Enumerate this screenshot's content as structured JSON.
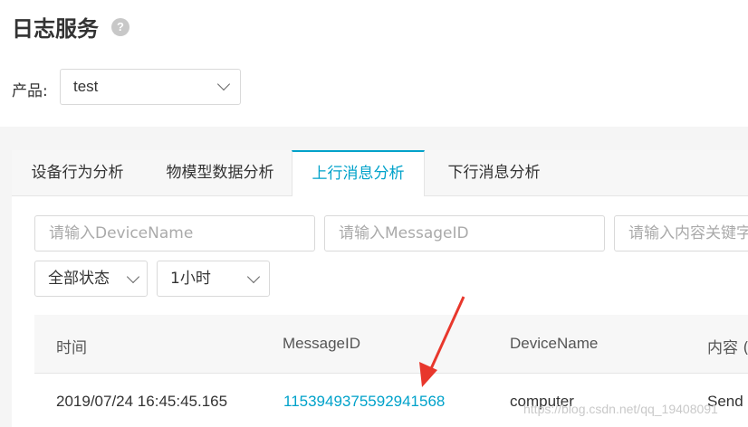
{
  "page": {
    "title": "日志服务",
    "help_glyph": "?"
  },
  "product": {
    "label": "产品:",
    "selected": "test"
  },
  "tabs": [
    {
      "label": "设备行为分析"
    },
    {
      "label": "物模型数据分析"
    },
    {
      "label": "上行消息分析",
      "active": true
    },
    {
      "label": "下行消息分析"
    }
  ],
  "filters": {
    "device_name_placeholder": "请输入DeviceName",
    "message_id_placeholder": "请输入MessageID",
    "content_keyword_placeholder": "请输入内容关键字",
    "status_selected": "全部状态",
    "time_range_selected": "1小时"
  },
  "table": {
    "columns": [
      "时间",
      "MessageID",
      "DeviceName",
      "内容 ("
    ],
    "rows": [
      {
        "time": "2019/07/24 16:45:45.165",
        "message_id": "1153949375592941568",
        "device_name": "computer",
        "content": "Send"
      }
    ]
  },
  "annotation": {
    "arrow_color": "#e8372c"
  },
  "watermark": "https://blog.csdn.net/qq_19408091",
  "colors": {
    "accent": "#00a2ca",
    "border": "#d9d9d9",
    "panel_bg": "#f5f5f5"
  }
}
